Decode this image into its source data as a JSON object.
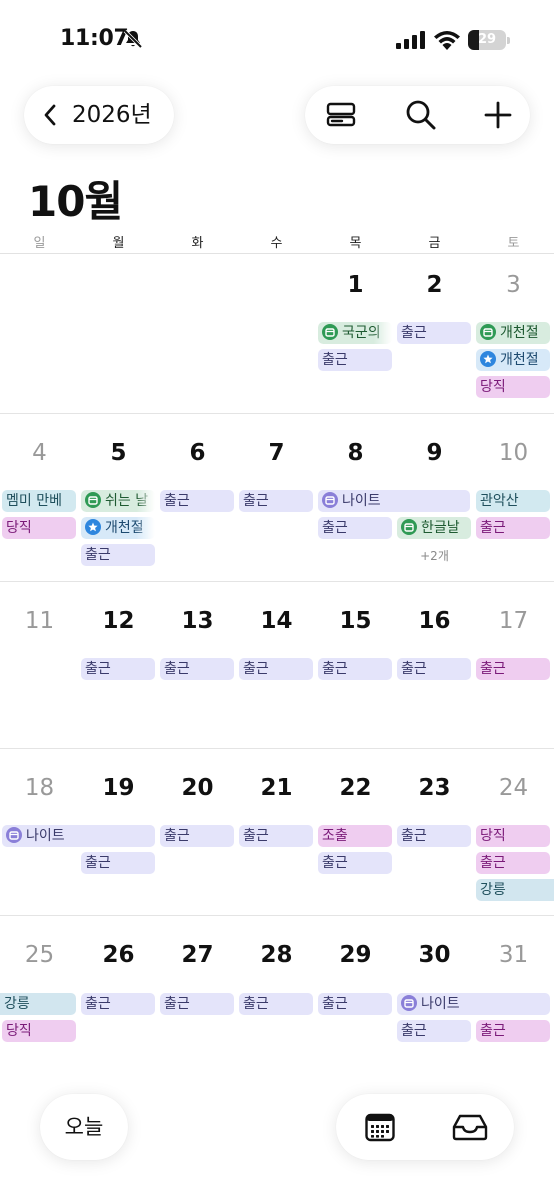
{
  "status_bar": {
    "time": "11:07",
    "battery": "29",
    "battery_level": 0.29
  },
  "header": {
    "year_label": "2026년",
    "month_title": "10월"
  },
  "icons": {
    "back": "chevron-left-icon",
    "view": "list-view-icon",
    "search": "search-icon",
    "add": "plus-icon",
    "calendar": "calendar-icon",
    "inbox": "inbox-icon",
    "bell": "bell-slash-icon"
  },
  "weekdays": [
    "일",
    "월",
    "화",
    "수",
    "목",
    "금",
    "토"
  ],
  "days": [
    "1",
    "2",
    "3",
    "4",
    "5",
    "6",
    "7",
    "8",
    "9",
    "10",
    "11",
    "12",
    "13",
    "14",
    "15",
    "16",
    "17",
    "18",
    "19",
    "20",
    "21",
    "22",
    "23",
    "24",
    "25",
    "26",
    "27",
    "28",
    "29",
    "30",
    "31"
  ],
  "events": {
    "gukgun": "국군의",
    "chulgeun": "출근",
    "gaecheonjeol": "개천절",
    "dangjik": "당직",
    "memmi": "멤미 만베",
    "swineun": "쉬는 날",
    "night": "나이트",
    "hangeulnal": "한글날",
    "gwanaksan": "관악산",
    "jochul": "조출",
    "gangneung": "강릉"
  },
  "more_count": "+2개",
  "bottom": {
    "today_label": "오늘"
  },
  "colors": {
    "work": "#e4e4fa",
    "duty": "#efcdf0",
    "holiday": "#d8ecdf",
    "info": "#d2e9f0"
  }
}
